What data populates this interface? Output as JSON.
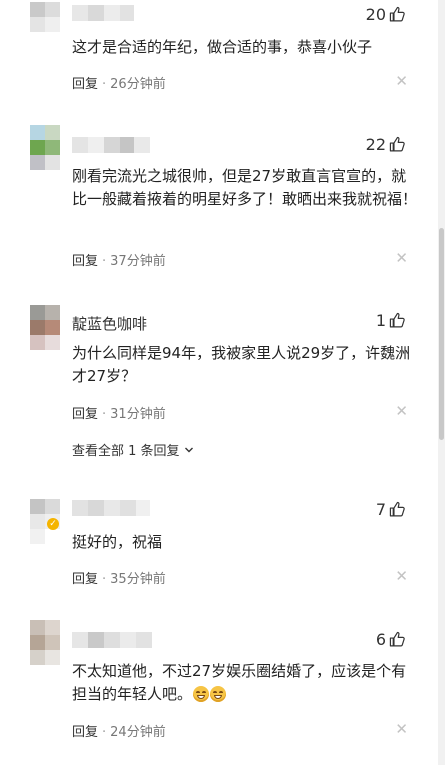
{
  "common": {
    "reply_label": "回复",
    "close_glyph": "✕",
    "thumb_icon": "thumb-up-icon"
  },
  "comments": [
    {
      "likes": "20",
      "text": "这才是合适的年纪，做合适的事，恭喜小伙子",
      "time": "26分钟前"
    },
    {
      "likes": "22",
      "text": "刚看完流光之城很帅，但是27岁敢直言官宣的，就比一般藏着掖着的明星好多了！敢晒出来我就祝福！",
      "time": "37分钟前"
    },
    {
      "username": "靛蓝色咖啡",
      "likes": "1",
      "text": "为什么同样是94年，我被家里人说29岁了，许魏洲才27岁？",
      "time": "31分钟前",
      "view_all": "查看全部 1 条回复"
    },
    {
      "likes": "7",
      "text": "挺好的，祝福",
      "time": "35分钟前"
    },
    {
      "likes": "6",
      "text": "不太知道他，不过27岁娱乐圈结婚了，应该是个有担当的年轻人吧。",
      "time": "24分钟前"
    }
  ]
}
